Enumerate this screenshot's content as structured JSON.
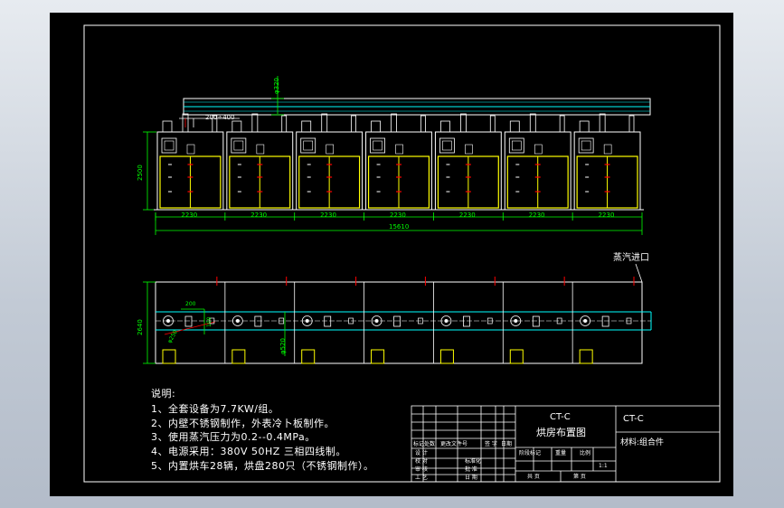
{
  "drawing": {
    "dim_pipe_diameter_top": "φ320",
    "dim_fan_offset": "200÷400",
    "dim_height": "2500",
    "dim_unit_width": "2230",
    "unit_count": 7,
    "dim_total_width": "15610",
    "steam_inlet_label": "蒸汽进口",
    "dim_plan_depth": "2640",
    "dim_inlet_width": "200",
    "dim_inlet_height": "100",
    "dim_fan_diameter": "φ250",
    "dim_pipe_diameter_plan": "φ520"
  },
  "notes": {
    "heading": "说明:",
    "items": [
      "1、全套设备为7.7KW/组。",
      "2、内壁不锈钢制作，外表冷卜板制作。",
      "3、使用蒸汽压力为0.2--0.4MPa。",
      "4、电源采用：380V 50HZ 三相四线制。",
      "5、内置烘车28辆，烘盘280只（不锈钢制作）。"
    ]
  },
  "title_block": {
    "model_center": "CT-C",
    "drawing_name": "烘房布置图",
    "model_right": "CT-C",
    "material_label": "材料:组合件",
    "row_labels": [
      "标记处数",
      "设 计",
      "校 对",
      "审 核",
      "工 艺"
    ],
    "change_doc_label": "更改文件号",
    "signature_label": "签 字",
    "date_label": "日期",
    "standardize_label": "标准化",
    "approve_label": "批 准",
    "date2_label": "日 期",
    "stage_label": "阶段标记",
    "weight_label": "重量",
    "scale_label": "比例",
    "scale_value": "1:1",
    "sheets_label": "共 页",
    "sheet_label": "第 页"
  },
  "colors": {
    "background": "#000000",
    "frame": "#ffffff",
    "cabinet": "#ffff00",
    "dimension": "#00ff00",
    "pipe": "#00ffff",
    "annotation": "#ff0000"
  }
}
